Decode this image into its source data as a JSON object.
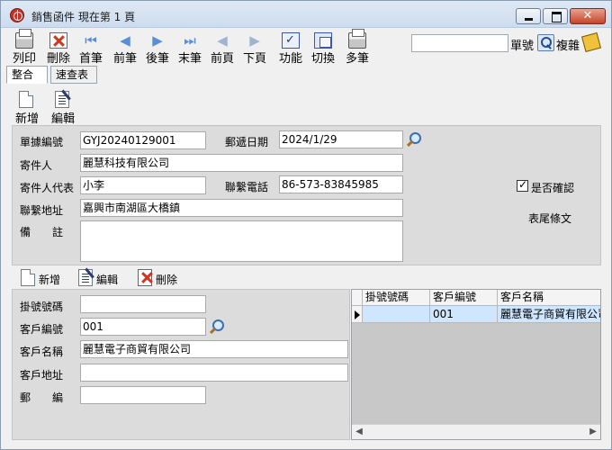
{
  "window": {
    "title": "銷售函件  現在第 1 頁",
    "controls": {
      "close": "✕"
    }
  },
  "toolbar": {
    "items": [
      {
        "label": "列印"
      },
      {
        "label": "刪除"
      },
      {
        "label": "首筆",
        "glyph": "⏮"
      },
      {
        "label": "前筆",
        "glyph": "◀"
      },
      {
        "label": "後筆",
        "glyph": "▶"
      },
      {
        "label": "末筆",
        "glyph": "⏭"
      },
      {
        "label": "前頁",
        "glyph": "◀"
      },
      {
        "label": "下頁",
        "glyph": "▶"
      },
      {
        "label": "功能"
      },
      {
        "label": "切換"
      },
      {
        "label": "多筆"
      }
    ],
    "search_value": "",
    "doc_no_label": "單號",
    "copy_label": "複雜"
  },
  "tabs": [
    {
      "label": "整合"
    },
    {
      "label": "速查表"
    }
  ],
  "header_actions": {
    "new": "新增",
    "edit": "編輯"
  },
  "form": {
    "doc_no": {
      "label": "單據編號",
      "value": "GYJ20240129001"
    },
    "mail_date": {
      "label": "郵遞日期",
      "value": "2024/1/29"
    },
    "sender": {
      "label": "寄件人",
      "value": "麗慧科技有限公司"
    },
    "sender_rep": {
      "label": "寄件人代表",
      "value": "小李"
    },
    "phone": {
      "label": "聯繫電話",
      "value": "86-573-83845985"
    },
    "address": {
      "label": "聯繫地址",
      "value": "嘉興市南湖區大橋鎮"
    },
    "remark": {
      "label": "備　　註",
      "value": ""
    },
    "confirmed": {
      "label": "是否確認",
      "checked": true
    },
    "footer_text": "表尾條文"
  },
  "detail_actions": {
    "new": "新增",
    "edit": "編輯",
    "delete": "刪除"
  },
  "detail_form": {
    "reg_no": {
      "label": "掛號號碼",
      "value": ""
    },
    "customer_no": {
      "label": "客戶編號",
      "value": "001"
    },
    "customer_name": {
      "label": "客戶名稱",
      "value": "麗慧電子商貿有限公司"
    },
    "customer_addr": {
      "label": "客戶地址",
      "value": ""
    },
    "postcode": {
      "label": "郵　　編",
      "value": ""
    }
  },
  "grid": {
    "columns": [
      "掛號號碼",
      "客戶編號",
      "客戶名稱"
    ],
    "rows": [
      [
        "",
        "001",
        "麗慧電子商貿有限公司"
      ]
    ]
  }
}
